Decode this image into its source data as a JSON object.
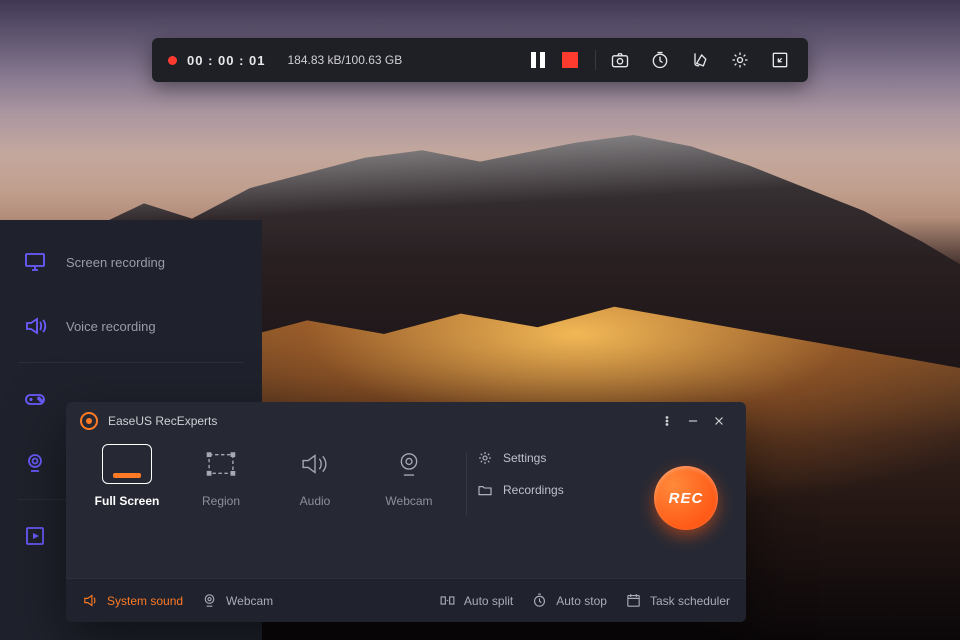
{
  "colors": {
    "accent": "#ff7a25",
    "purple": "#6b5cff",
    "panel": "#262934",
    "bar": "#1f2026"
  },
  "rec_bar": {
    "time": "00 : 00 : 01",
    "storage": "184.83 kB/100.63 GB"
  },
  "sidebar": {
    "items": [
      {
        "label": "Screen recording"
      },
      {
        "label": "Voice recording"
      },
      {
        "label": ""
      },
      {
        "label": ""
      },
      {
        "label": ""
      }
    ]
  },
  "app": {
    "title": "EaseUS RecExperts",
    "modes": [
      {
        "label": "Full Screen"
      },
      {
        "label": "Region"
      },
      {
        "label": "Audio"
      },
      {
        "label": "Webcam"
      }
    ],
    "links": [
      {
        "label": "Settings"
      },
      {
        "label": "Recordings"
      }
    ],
    "rec_label": "REC",
    "bottom": {
      "system_sound": "System sound",
      "webcam": "Webcam",
      "auto_split": "Auto split",
      "auto_stop": "Auto stop",
      "task_scheduler": "Task scheduler"
    }
  }
}
